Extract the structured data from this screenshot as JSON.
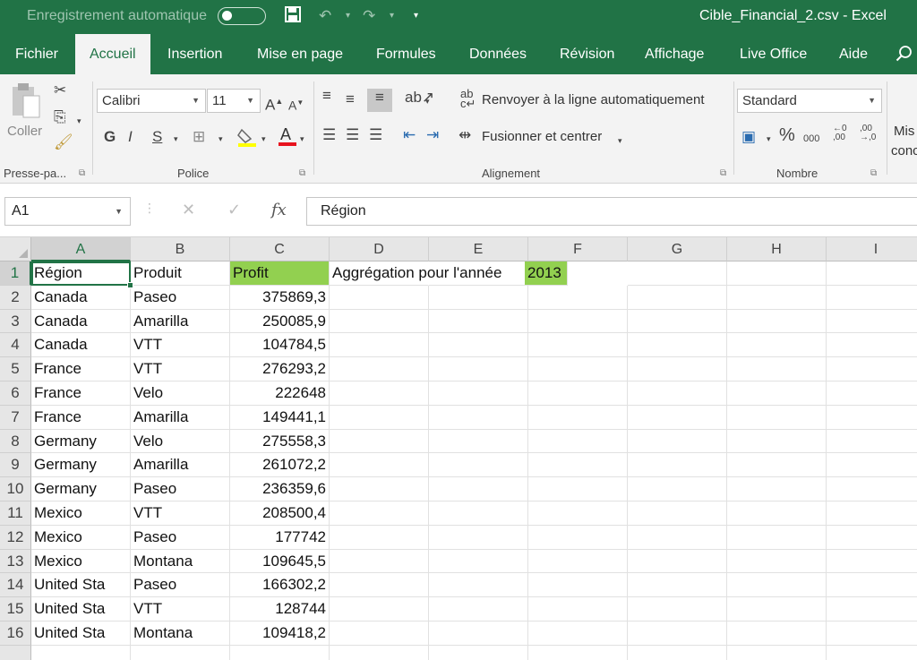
{
  "titlebar": {
    "autosave_label": "Enregistrement automatique",
    "doc_title": "Cible_Financial_2.csv  -  Excel"
  },
  "tabs": [
    {
      "label": "Fichier"
    },
    {
      "label": "Accueil",
      "active": true
    },
    {
      "label": "Insertion"
    },
    {
      "label": "Mise en page"
    },
    {
      "label": "Formules"
    },
    {
      "label": "Données"
    },
    {
      "label": "Révision"
    },
    {
      "label": "Affichage"
    },
    {
      "label": "Live Office"
    },
    {
      "label": "Aide"
    }
  ],
  "ribbon": {
    "clipboard": {
      "paste_label": "Coller",
      "group_label": "Presse-pa..."
    },
    "font": {
      "font_name": "Calibri",
      "font_size": "11",
      "bold": "G",
      "italic": "I",
      "underline": "S",
      "group_label": "Police"
    },
    "alignment": {
      "wrap_label": "Renvoyer à la ligne automatiquement",
      "merge_label": "Fusionner et centrer",
      "group_label": "Alignement"
    },
    "number": {
      "format": "Standard",
      "percent": "%",
      "thousands": "000",
      "group_label": "Nombre"
    },
    "cut_off": {
      "line1": "Mis",
      "line2": "conc"
    }
  },
  "formula_bar": {
    "name_box": "A1",
    "formula": "Région"
  },
  "grid": {
    "columns": [
      "A",
      "B",
      "C",
      "D",
      "E",
      "F",
      "G",
      "H",
      "I"
    ],
    "selected_column": "A",
    "selected_row": "1",
    "header_row": {
      "a": "Région",
      "b": "Produit",
      "c": "Profit",
      "d": "Aggrégation pour l'année",
      "f": "2013"
    },
    "rows": [
      {
        "n": "2",
        "region": "Canada",
        "product": "Paseo",
        "profit": "375869,3"
      },
      {
        "n": "3",
        "region": "Canada",
        "product": "Amarilla",
        "profit": "250085,9"
      },
      {
        "n": "4",
        "region": "Canada",
        "product": "VTT",
        "profit": "104784,5"
      },
      {
        "n": "5",
        "region": "France",
        "product": "VTT",
        "profit": "276293,2"
      },
      {
        "n": "6",
        "region": "France",
        "product": "Velo",
        "profit": "222648"
      },
      {
        "n": "7",
        "region": "France",
        "product": "Amarilla",
        "profit": "149441,1"
      },
      {
        "n": "8",
        "region": "Germany",
        "product": "Velo",
        "profit": "275558,3"
      },
      {
        "n": "9",
        "region": "Germany",
        "product": "Amarilla",
        "profit": "261072,2"
      },
      {
        "n": "10",
        "region": "Germany",
        "product": "Paseo",
        "profit": "236359,6"
      },
      {
        "n": "11",
        "region": "Mexico",
        "product": "VTT",
        "profit": "208500,4"
      },
      {
        "n": "12",
        "region": "Mexico",
        "product": "Paseo",
        "profit": "177742"
      },
      {
        "n": "13",
        "region": "Mexico",
        "product": "Montana",
        "profit": "109645,5"
      },
      {
        "n": "14",
        "region": "United Sta",
        "product": "Paseo",
        "profit": "166302,2"
      },
      {
        "n": "15",
        "region": "United Sta",
        "product": "VTT",
        "profit": "128744"
      },
      {
        "n": "16",
        "region": "United Sta",
        "product": "Montana",
        "profit": "109418,2"
      }
    ]
  },
  "colors": {
    "excel_green": "#217346",
    "highlight_green": "#92d050"
  }
}
